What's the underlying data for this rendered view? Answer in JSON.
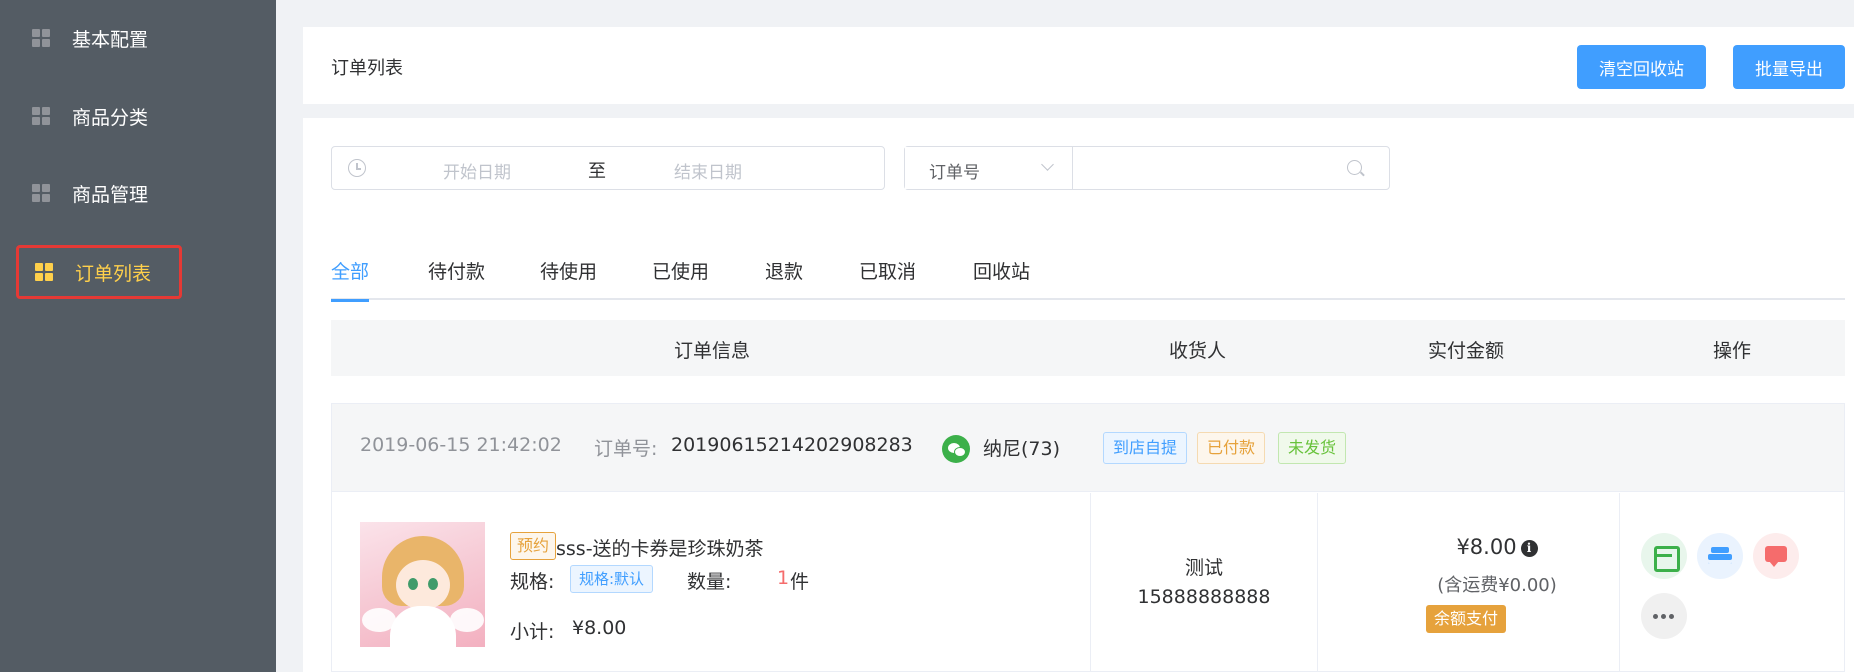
{
  "sidebar": {
    "items": [
      {
        "label": "基本配置",
        "active": false
      },
      {
        "label": "商品分类",
        "active": false
      },
      {
        "label": "商品管理",
        "active": false
      },
      {
        "label": "订单列表",
        "active": true
      }
    ]
  },
  "header": {
    "title": "订单列表",
    "clear_recycle_label": "清空回收站",
    "batch_export_label": "批量导出"
  },
  "filters": {
    "start_date_placeholder": "开始日期",
    "range_separator": "至",
    "end_date_placeholder": "结束日期",
    "search_type": "订单号",
    "search_value": ""
  },
  "tabs": [
    "全部",
    "待付款",
    "待使用",
    "已使用",
    "退款",
    "已取消",
    "回收站"
  ],
  "active_tab": "全部",
  "table": {
    "columns": [
      "订单信息",
      "收货人",
      "实付金额",
      "操作"
    ]
  },
  "order": {
    "time": "2019-06-15 21:42:02",
    "order_no_label": "订单号:",
    "order_no": "20190615214202908283",
    "buyer": "纳尼(73)",
    "tags": [
      "到店自提",
      "已付款",
      "未发货"
    ],
    "product": {
      "badge": "预约",
      "name": "sss-送的卡券是珍珠奶茶",
      "spec_label": "规格:",
      "spec": "规格:默认",
      "qty_label": "数量:",
      "qty": "1",
      "qty_unit": "件",
      "subtotal_label": "小计:",
      "subtotal": "¥8.00"
    },
    "receiver_name": "测试",
    "receiver_phone": "15888888888",
    "amount": "¥8.00",
    "shipping": "(含运费¥0.00)",
    "pay_method": "余额支付"
  },
  "colors": {
    "sidebar_bg": "#545c64",
    "active_text": "#ffd04b",
    "primary": "#409eff"
  }
}
